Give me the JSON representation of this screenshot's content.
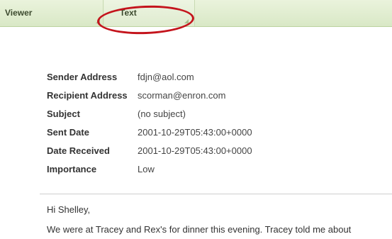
{
  "tabs": {
    "viewer_label": "Viewer",
    "text_label": "Text"
  },
  "email": {
    "fields": [
      {
        "label": "Sender Address",
        "value": "fdjn@aol.com"
      },
      {
        "label": "Recipient Address",
        "value": "scorman@enron.com"
      },
      {
        "label": "Subject",
        "value": "(no subject)"
      },
      {
        "label": "Sent Date",
        "value": "2001-10-29T05:43:00+0000"
      },
      {
        "label": "Date Received",
        "value": "2001-10-29T05:43:00+0000"
      },
      {
        "label": "Importance",
        "value": "Low"
      }
    ],
    "greeting": "Hi Shelley,",
    "body_line_1": "We were at Tracey and Rex's for dinner this evening. Tracey told me about"
  },
  "colors": {
    "tabbar_bg": "#d9e8c6",
    "annotation": "#c4141c"
  }
}
